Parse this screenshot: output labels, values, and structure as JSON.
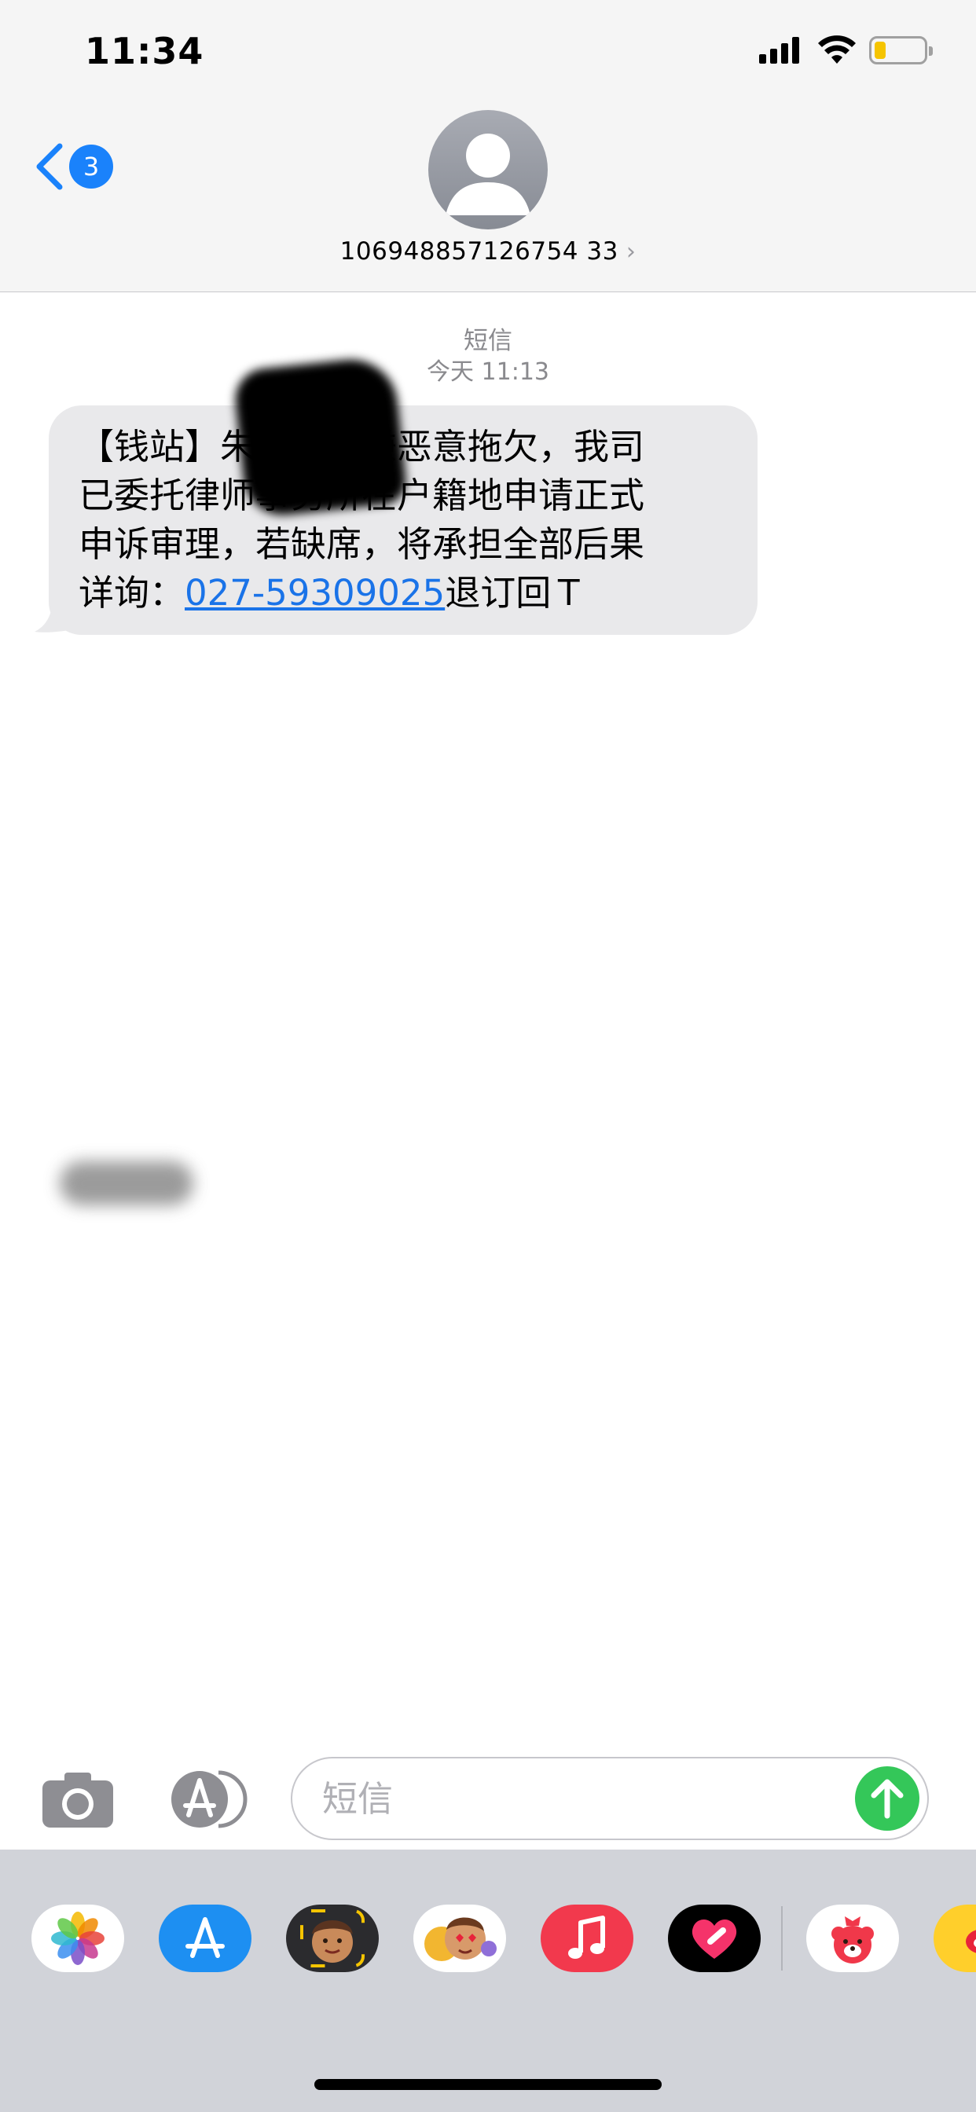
{
  "status_bar": {
    "time": "11:34",
    "signal_bars": 4,
    "battery_level": 0.15,
    "battery_color": "#f5c400"
  },
  "header": {
    "back_badge_count": "3",
    "contact_name": "106948857126754 33",
    "contact_chevron": "›",
    "accent_color": "#1a82fb",
    "avatar_icon": "person-icon"
  },
  "conversation": {
    "service_label": "短信",
    "timestamp": "今天 11:13",
    "messages": [
      {
        "direction": "incoming",
        "lines": [
          "【钱站】朱雷　步嫌恶意拖欠，我司",
          "已委托律师事务所在户籍地申请正式",
          "申诉审理，若缺席，将承担全部后果"
        ],
        "last_line_prefix": "详询：",
        "link_text": "027-59309025",
        "last_line_suffix": "退订回Ｔ"
      }
    ]
  },
  "input_bar": {
    "placeholder": "短信",
    "camera_icon": "camera-icon",
    "apps_icon": "app-store-icon",
    "send_icon": "arrow-up-icon",
    "send_color": "#34c759"
  },
  "app_drawer": {
    "apps": [
      {
        "name": "photos",
        "icon": "photos-icon"
      },
      {
        "name": "app-store",
        "icon": "app-store-icon"
      },
      {
        "name": "memoji",
        "icon": "memoji-icon"
      },
      {
        "name": "memoji-stickers",
        "icon": "memoji-stickers-icon"
      },
      {
        "name": "music",
        "icon": "music-icon"
      },
      {
        "name": "digital-touch",
        "icon": "digital-touch-icon"
      },
      {
        "name": "bear-app",
        "icon": "bear-icon"
      },
      {
        "name": "weibo",
        "icon": "weibo-icon"
      }
    ]
  }
}
